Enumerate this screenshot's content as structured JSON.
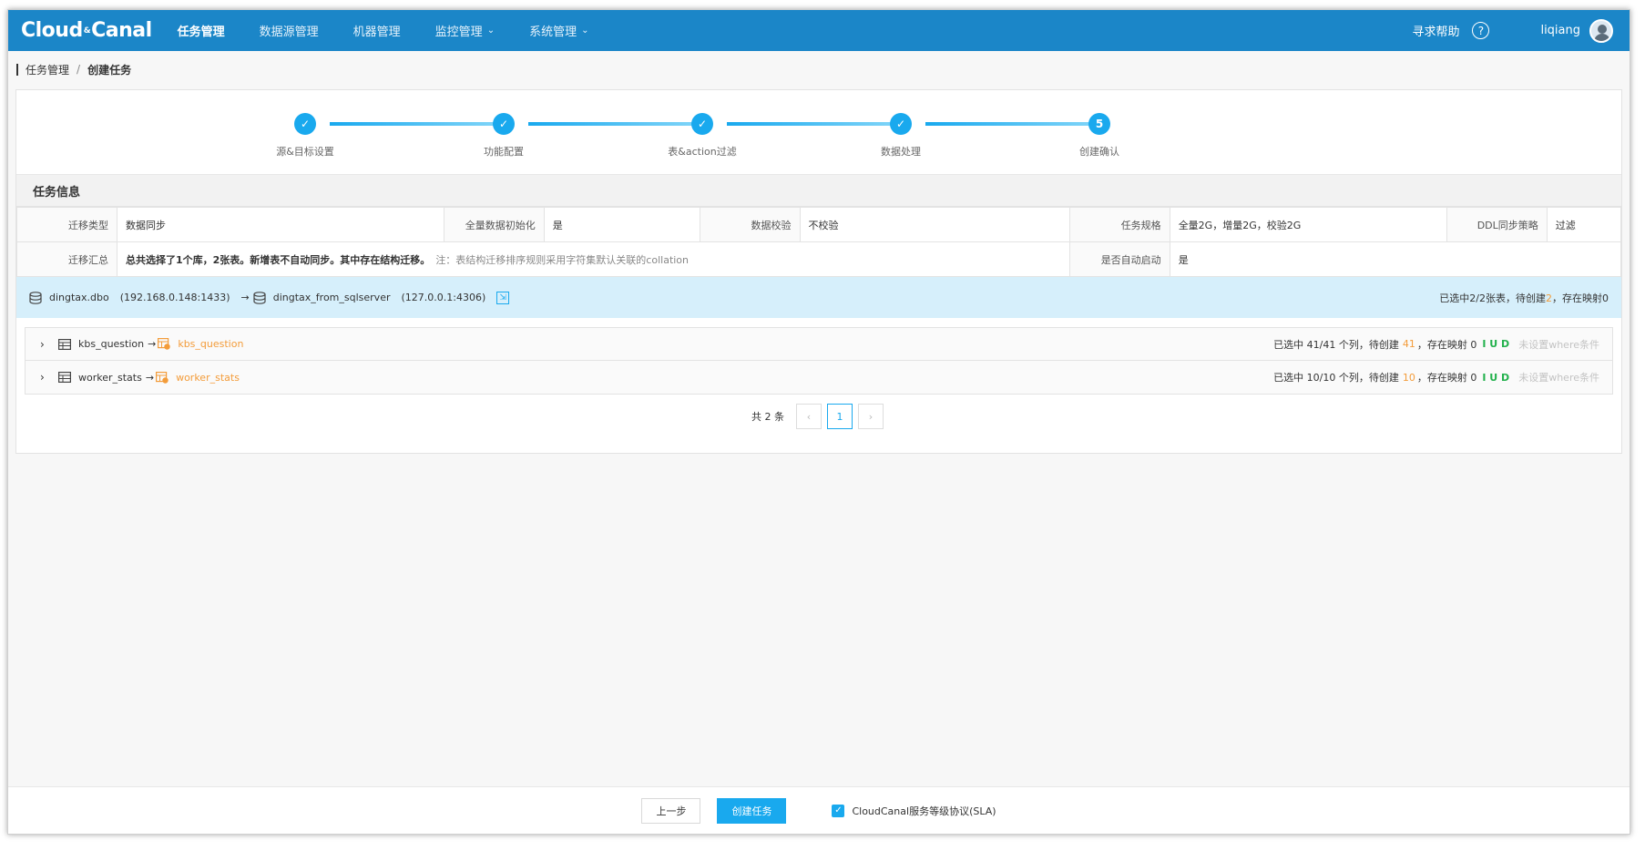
{
  "topnav": {
    "logo_left": "Cloud",
    "logo_mid": "&",
    "logo_right": "Canal",
    "items": [
      {
        "label": "任务管理",
        "active": true
      },
      {
        "label": "数据源管理"
      },
      {
        "label": "机器管理"
      },
      {
        "label": "监控管理",
        "dropdown": true
      },
      {
        "label": "系统管理",
        "dropdown": true
      }
    ],
    "help": "寻求帮助",
    "help_icon": "?",
    "user": "liqiang"
  },
  "breadcrumb": {
    "parent": "任务管理",
    "sep": "/",
    "current": "创建任务"
  },
  "steps": [
    {
      "label": "源&目标设置",
      "done": true
    },
    {
      "label": "功能配置",
      "done": true
    },
    {
      "label": "表&action过滤",
      "done": true
    },
    {
      "label": "数据处理",
      "done": true
    },
    {
      "label": "创建确认",
      "num": "5"
    }
  ],
  "section_title": "任务信息",
  "info": {
    "row1": [
      {
        "k": "迁移类型",
        "v": "数据同步"
      },
      {
        "k": "全量数据初始化",
        "v": "是"
      },
      {
        "k": "数据校验",
        "v": "不校验"
      },
      {
        "k": "任务规格",
        "v": "全量2G，增量2G，校验2G"
      },
      {
        "k": "DDL同步策略",
        "v": "过滤"
      }
    ],
    "summary_k": "迁移汇总",
    "summary_v": "总共选择了1个库，2张表。新增表不自动同步。其中存在结构迁移。",
    "summary_note": "注：表结构迁移排序规则采用字符集默认关联的collation",
    "autostart_k": "是否自动启动",
    "autostart_v": "是"
  },
  "dbbar": {
    "src_db": "dingtax.dbo",
    "src_addr": "(192.168.0.148:1433)",
    "arrow": "→",
    "tgt_db": "dingtax_from_sqlserver",
    "tgt_addr": "(127.0.0.1:4306)",
    "right_a": "已选中2/2张表，待创建",
    "right_num": "2",
    "right_b": "，存在映射0"
  },
  "tables": [
    {
      "src": "kbs_question",
      "tgt": "kbs_question",
      "a": "已选中 41/41 个列，待创建",
      "n": "41",
      "b": "，存在映射 0",
      "iud": "I U D",
      "where": "未设置where条件"
    },
    {
      "src": "worker_stats",
      "tgt": "worker_stats",
      "a": "已选中 10/10 个列，待创建",
      "n": "10",
      "b": "，存在映射 0",
      "iud": "I U D",
      "where": "未设置where条件"
    }
  ],
  "pager": {
    "total": "共 2 条",
    "prev": "‹",
    "page": "1",
    "next": "›"
  },
  "footer": {
    "prev": "上一步",
    "create": "创建任务",
    "sla": "CloudCanal服务等级协议(SLA)"
  },
  "colors": {
    "nav": "#1b86c8",
    "accent": "#19a9ee",
    "orange": "#f39c3a",
    "green": "#22b14c"
  }
}
